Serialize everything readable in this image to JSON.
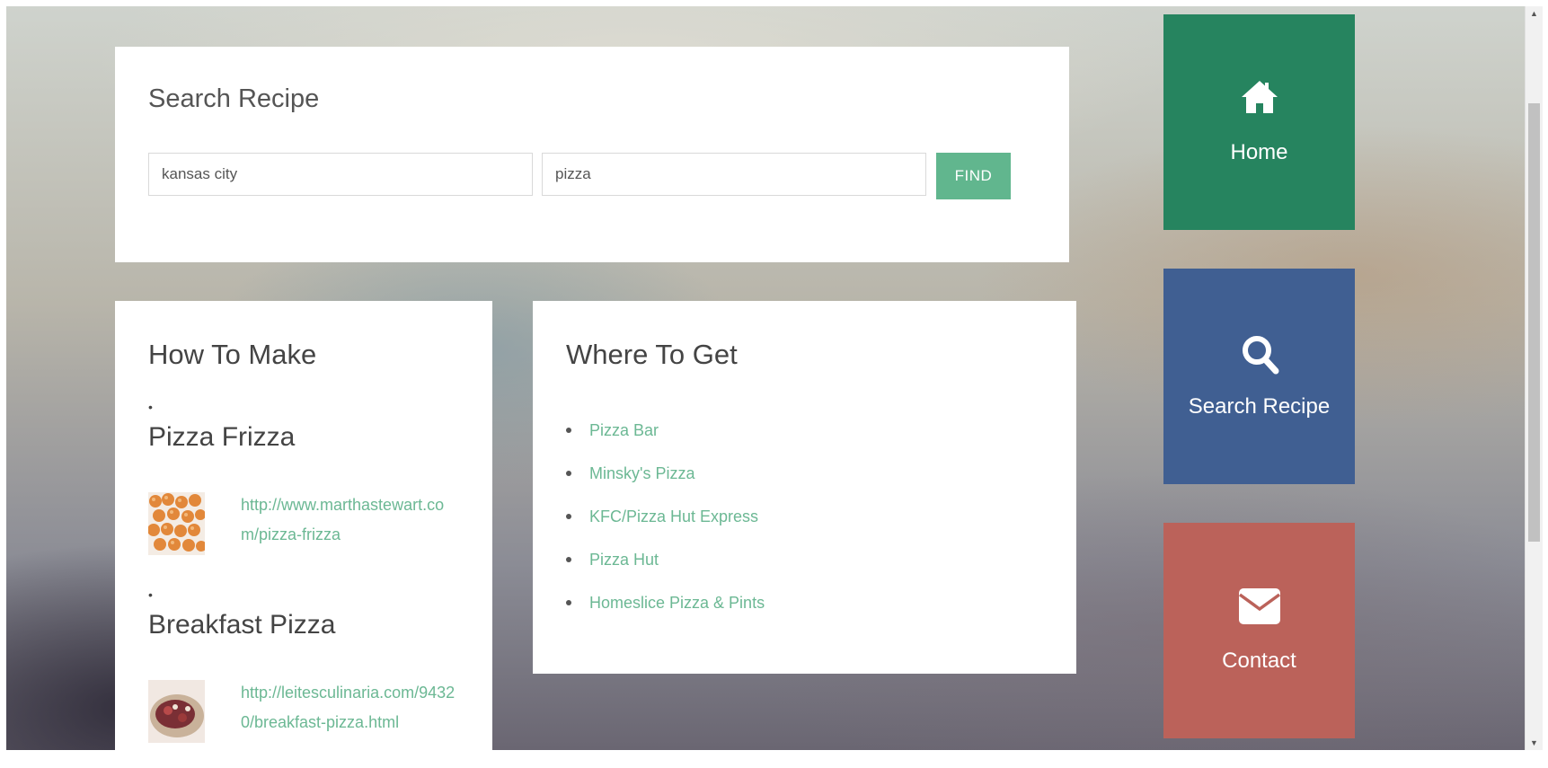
{
  "search": {
    "title": "Search Recipe",
    "location_value": "kansas city",
    "term_value": "pizza",
    "find_label": "FIND"
  },
  "how_to_make": {
    "title": "How To Make",
    "recipes": [
      {
        "bullet": "•",
        "name": "Pizza Frizza",
        "url": "http://www.marthastewart.com/pizza-frizza"
      },
      {
        "bullet": "•",
        "name": "Breakfast Pizza",
        "url": "http://leitesculinaria.com/94320/breakfast-pizza.html"
      }
    ]
  },
  "where_to_get": {
    "title": "Where To Get",
    "places": [
      "Pizza Bar",
      "Minsky's Pizza",
      "KFC/Pizza Hut Express",
      "Pizza Hut",
      "Homeslice Pizza & Pints"
    ]
  },
  "nav_tiles": {
    "home": {
      "label": "Home",
      "icon": "home-icon",
      "color": "#26845f"
    },
    "search": {
      "label": "Search Recipe",
      "icon": "search-icon",
      "color": "#405f92"
    },
    "contact": {
      "label": "Contact",
      "icon": "envelope-icon",
      "color": "#bb625a"
    }
  },
  "colors": {
    "accent_green": "#61b68e",
    "link_green": "#6cb894"
  }
}
